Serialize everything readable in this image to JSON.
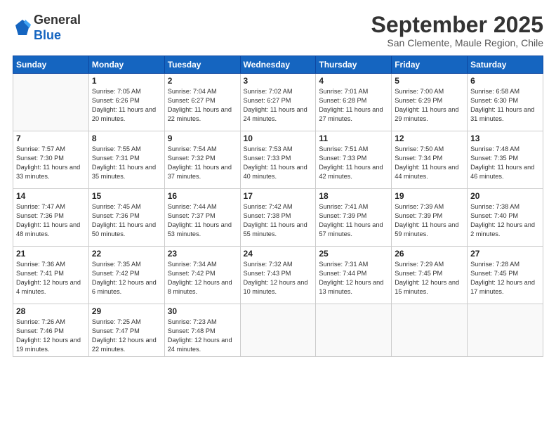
{
  "header": {
    "logo_line1": "General",
    "logo_line2": "Blue",
    "month": "September 2025",
    "location": "San Clemente, Maule Region, Chile"
  },
  "days_of_week": [
    "Sunday",
    "Monday",
    "Tuesday",
    "Wednesday",
    "Thursday",
    "Friday",
    "Saturday"
  ],
  "weeks": [
    [
      {
        "day": "",
        "sunrise": "",
        "sunset": "",
        "daylight": ""
      },
      {
        "day": "1",
        "sunrise": "Sunrise: 7:05 AM",
        "sunset": "Sunset: 6:26 PM",
        "daylight": "Daylight: 11 hours and 20 minutes."
      },
      {
        "day": "2",
        "sunrise": "Sunrise: 7:04 AM",
        "sunset": "Sunset: 6:27 PM",
        "daylight": "Daylight: 11 hours and 22 minutes."
      },
      {
        "day": "3",
        "sunrise": "Sunrise: 7:02 AM",
        "sunset": "Sunset: 6:27 PM",
        "daylight": "Daylight: 11 hours and 24 minutes."
      },
      {
        "day": "4",
        "sunrise": "Sunrise: 7:01 AM",
        "sunset": "Sunset: 6:28 PM",
        "daylight": "Daylight: 11 hours and 27 minutes."
      },
      {
        "day": "5",
        "sunrise": "Sunrise: 7:00 AM",
        "sunset": "Sunset: 6:29 PM",
        "daylight": "Daylight: 11 hours and 29 minutes."
      },
      {
        "day": "6",
        "sunrise": "Sunrise: 6:58 AM",
        "sunset": "Sunset: 6:30 PM",
        "daylight": "Daylight: 11 hours and 31 minutes."
      }
    ],
    [
      {
        "day": "7",
        "sunrise": "Sunrise: 7:57 AM",
        "sunset": "Sunset: 7:30 PM",
        "daylight": "Daylight: 11 hours and 33 minutes."
      },
      {
        "day": "8",
        "sunrise": "Sunrise: 7:55 AM",
        "sunset": "Sunset: 7:31 PM",
        "daylight": "Daylight: 11 hours and 35 minutes."
      },
      {
        "day": "9",
        "sunrise": "Sunrise: 7:54 AM",
        "sunset": "Sunset: 7:32 PM",
        "daylight": "Daylight: 11 hours and 37 minutes."
      },
      {
        "day": "10",
        "sunrise": "Sunrise: 7:53 AM",
        "sunset": "Sunset: 7:33 PM",
        "daylight": "Daylight: 11 hours and 40 minutes."
      },
      {
        "day": "11",
        "sunrise": "Sunrise: 7:51 AM",
        "sunset": "Sunset: 7:33 PM",
        "daylight": "Daylight: 11 hours and 42 minutes."
      },
      {
        "day": "12",
        "sunrise": "Sunrise: 7:50 AM",
        "sunset": "Sunset: 7:34 PM",
        "daylight": "Daylight: 11 hours and 44 minutes."
      },
      {
        "day": "13",
        "sunrise": "Sunrise: 7:48 AM",
        "sunset": "Sunset: 7:35 PM",
        "daylight": "Daylight: 11 hours and 46 minutes."
      }
    ],
    [
      {
        "day": "14",
        "sunrise": "Sunrise: 7:47 AM",
        "sunset": "Sunset: 7:36 PM",
        "daylight": "Daylight: 11 hours and 48 minutes."
      },
      {
        "day": "15",
        "sunrise": "Sunrise: 7:45 AM",
        "sunset": "Sunset: 7:36 PM",
        "daylight": "Daylight: 11 hours and 50 minutes."
      },
      {
        "day": "16",
        "sunrise": "Sunrise: 7:44 AM",
        "sunset": "Sunset: 7:37 PM",
        "daylight": "Daylight: 11 hours and 53 minutes."
      },
      {
        "day": "17",
        "sunrise": "Sunrise: 7:42 AM",
        "sunset": "Sunset: 7:38 PM",
        "daylight": "Daylight: 11 hours and 55 minutes."
      },
      {
        "day": "18",
        "sunrise": "Sunrise: 7:41 AM",
        "sunset": "Sunset: 7:39 PM",
        "daylight": "Daylight: 11 hours and 57 minutes."
      },
      {
        "day": "19",
        "sunrise": "Sunrise: 7:39 AM",
        "sunset": "Sunset: 7:39 PM",
        "daylight": "Daylight: 11 hours and 59 minutes."
      },
      {
        "day": "20",
        "sunrise": "Sunrise: 7:38 AM",
        "sunset": "Sunset: 7:40 PM",
        "daylight": "Daylight: 12 hours and 2 minutes."
      }
    ],
    [
      {
        "day": "21",
        "sunrise": "Sunrise: 7:36 AM",
        "sunset": "Sunset: 7:41 PM",
        "daylight": "Daylight: 12 hours and 4 minutes."
      },
      {
        "day": "22",
        "sunrise": "Sunrise: 7:35 AM",
        "sunset": "Sunset: 7:42 PM",
        "daylight": "Daylight: 12 hours and 6 minutes."
      },
      {
        "day": "23",
        "sunrise": "Sunrise: 7:34 AM",
        "sunset": "Sunset: 7:42 PM",
        "daylight": "Daylight: 12 hours and 8 minutes."
      },
      {
        "day": "24",
        "sunrise": "Sunrise: 7:32 AM",
        "sunset": "Sunset: 7:43 PM",
        "daylight": "Daylight: 12 hours and 10 minutes."
      },
      {
        "day": "25",
        "sunrise": "Sunrise: 7:31 AM",
        "sunset": "Sunset: 7:44 PM",
        "daylight": "Daylight: 12 hours and 13 minutes."
      },
      {
        "day": "26",
        "sunrise": "Sunrise: 7:29 AM",
        "sunset": "Sunset: 7:45 PM",
        "daylight": "Daylight: 12 hours and 15 minutes."
      },
      {
        "day": "27",
        "sunrise": "Sunrise: 7:28 AM",
        "sunset": "Sunset: 7:45 PM",
        "daylight": "Daylight: 12 hours and 17 minutes."
      }
    ],
    [
      {
        "day": "28",
        "sunrise": "Sunrise: 7:26 AM",
        "sunset": "Sunset: 7:46 PM",
        "daylight": "Daylight: 12 hours and 19 minutes."
      },
      {
        "day": "29",
        "sunrise": "Sunrise: 7:25 AM",
        "sunset": "Sunset: 7:47 PM",
        "daylight": "Daylight: 12 hours and 22 minutes."
      },
      {
        "day": "30",
        "sunrise": "Sunrise: 7:23 AM",
        "sunset": "Sunset: 7:48 PM",
        "daylight": "Daylight: 12 hours and 24 minutes."
      },
      {
        "day": "",
        "sunrise": "",
        "sunset": "",
        "daylight": ""
      },
      {
        "day": "",
        "sunrise": "",
        "sunset": "",
        "daylight": ""
      },
      {
        "day": "",
        "sunrise": "",
        "sunset": "",
        "daylight": ""
      },
      {
        "day": "",
        "sunrise": "",
        "sunset": "",
        "daylight": ""
      }
    ]
  ]
}
